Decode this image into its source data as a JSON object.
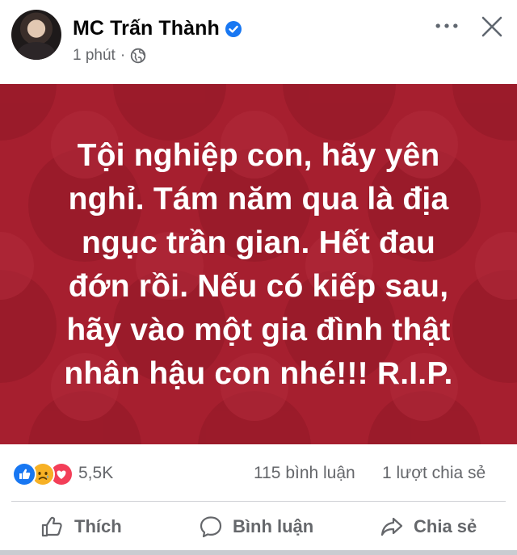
{
  "post": {
    "author": "MC Trấn Thành",
    "timestamp": "1 phút",
    "separator": "·",
    "privacy_icon": "globe-icon",
    "verified_icon": "verified-badge-icon",
    "more_icon": "more-options-icon",
    "close_icon": "close-icon"
  },
  "image": {
    "background_color": "#a61f2f",
    "text": "Tội nghiệp con, hãy yên\nnghỉ.  Tám năm qua là địa\nngục trần gian. Hết đau\nđớn rồi. Nếu có kiếp sau,\nhãy vào một gia đình thật\nnhân hậu con nhé!!! R.I.P."
  },
  "stats": {
    "reaction_icons": [
      "like-reaction-icon",
      "sad-reaction-icon",
      "love-reaction-icon"
    ],
    "reaction_count": "5,5K",
    "comments": "115 bình luận",
    "shares": "1 lượt chia sẻ"
  },
  "actions": {
    "like_label": "Thích",
    "comment_label": "Bình luận",
    "share_label": "Chia sẻ"
  },
  "colors": {
    "accent": "#1877f2",
    "muted_text": "#65676b",
    "love": "#f33e58",
    "sad": "#f7b125"
  }
}
